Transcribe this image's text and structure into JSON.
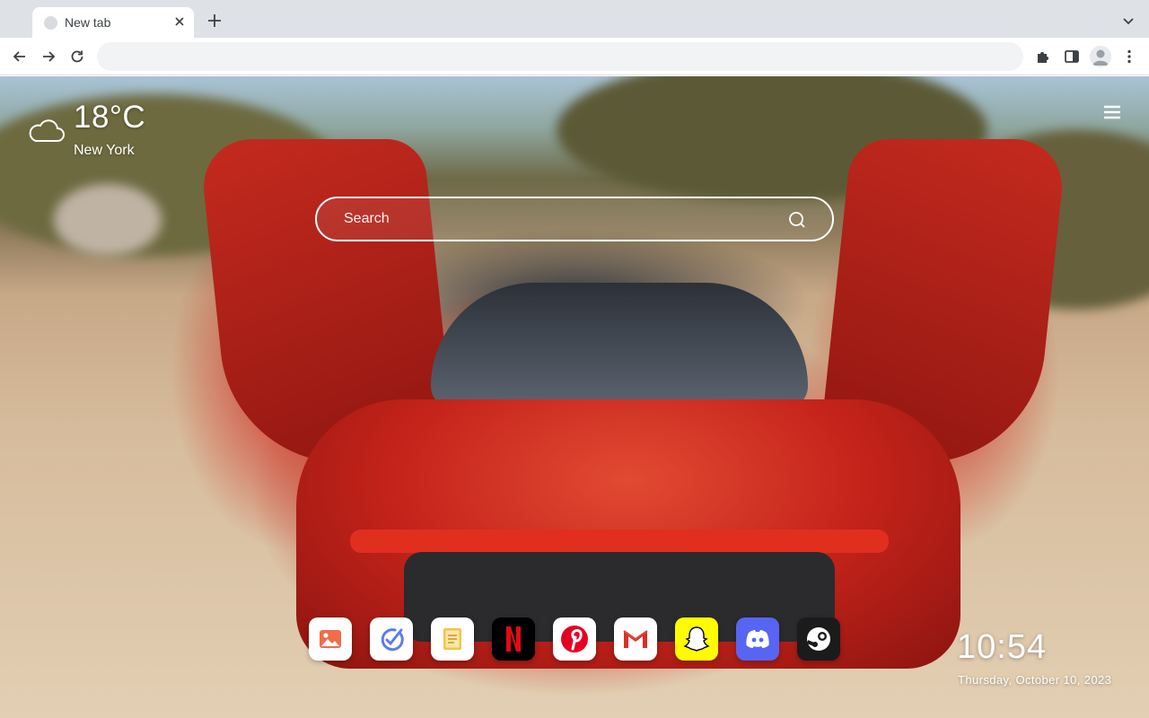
{
  "browser": {
    "tab": {
      "title": "New tab",
      "close_icon": "close-icon"
    },
    "omnibox": {
      "value": "",
      "placeholder": ""
    }
  },
  "page": {
    "weather": {
      "temperature": "18°C",
      "city": "New York",
      "condition_icon": "cloud-icon"
    },
    "search": {
      "placeholder": "Search"
    },
    "dock": {
      "apps": [
        {
          "name": "Photos",
          "icon": "photos-icon",
          "bg": "#ffffff"
        },
        {
          "name": "Tasks",
          "icon": "tasks-icon",
          "bg": "#ffffff"
        },
        {
          "name": "Notes",
          "icon": "notes-icon",
          "bg": "#ffffff"
        },
        {
          "name": "Netflix",
          "icon": "netflix-icon",
          "bg": "#000000",
          "accent": "#e50914"
        },
        {
          "name": "Pinterest",
          "icon": "pinterest-icon",
          "bg": "#ffffff",
          "accent": "#e60023"
        },
        {
          "name": "Gmail",
          "icon": "gmail-icon",
          "bg": "#ffffff",
          "accent": "#d93025"
        },
        {
          "name": "Snapchat",
          "icon": "snapchat-icon",
          "bg": "#fffc00"
        },
        {
          "name": "Discord",
          "icon": "discord-icon",
          "bg": "#5865f2"
        },
        {
          "name": "Steam",
          "icon": "steam-icon",
          "bg": "#1b1b1b"
        }
      ]
    },
    "clock": {
      "time": "10:54",
      "date": "Thursday, October 10, 2023"
    }
  }
}
